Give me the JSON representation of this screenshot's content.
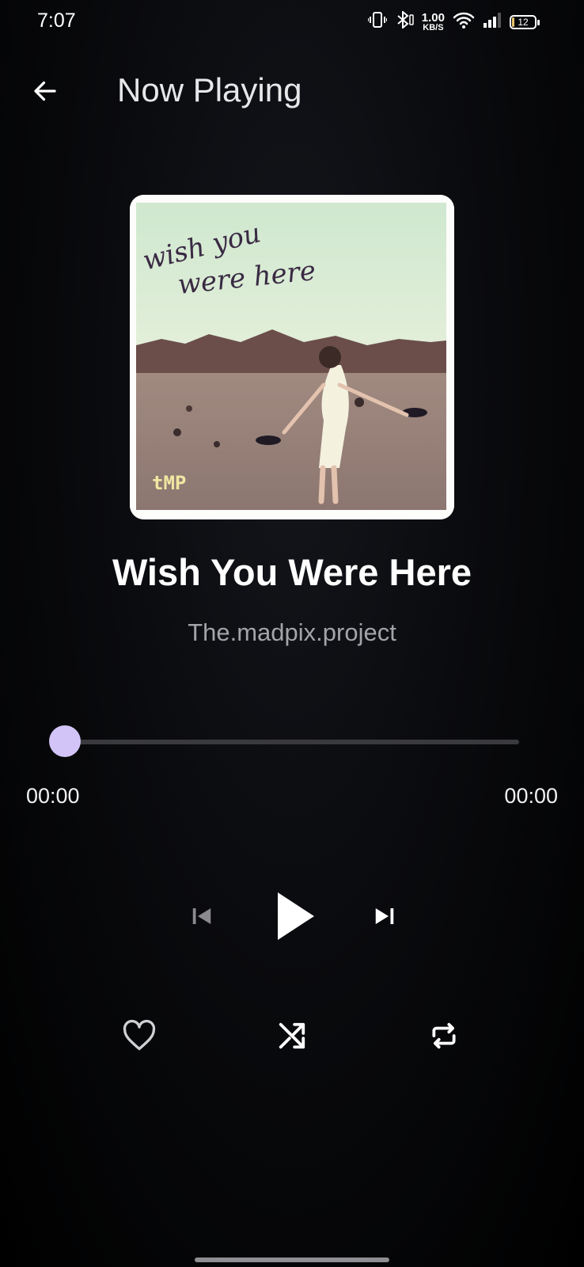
{
  "status_bar": {
    "time": "7:07",
    "net_speed_value": "1.00",
    "net_speed_unit": "KB/S",
    "battery_level": "12",
    "icons": [
      "vibrate-icon",
      "bluetooth-icon",
      "wifi-icon",
      "signal-icon",
      "battery-icon"
    ]
  },
  "app_bar": {
    "title": "Now Playing",
    "back_icon": "arrow-left-icon"
  },
  "album_art": {
    "cover_text_line1": "wish you",
    "cover_text_line2": "were here",
    "cover_logo": "tMP"
  },
  "track": {
    "title": "Wish You Were Here",
    "artist": "The.madpix.project"
  },
  "progress": {
    "elapsed": "00:00",
    "duration": "00:00",
    "fraction": 0
  },
  "controls": {
    "previous_icon": "skip-previous-icon",
    "play_icon": "play-icon",
    "next_icon": "skip-next-icon",
    "favorite_icon": "heart-outline-icon",
    "shuffle_icon": "shuffle-icon",
    "repeat_icon": "repeat-icon"
  },
  "colors": {
    "accent": "#d3c4f8",
    "track_inactive": "#3a3a3e",
    "artist_text": "#a3a3a9",
    "battery_fill": "#e9c46a"
  }
}
